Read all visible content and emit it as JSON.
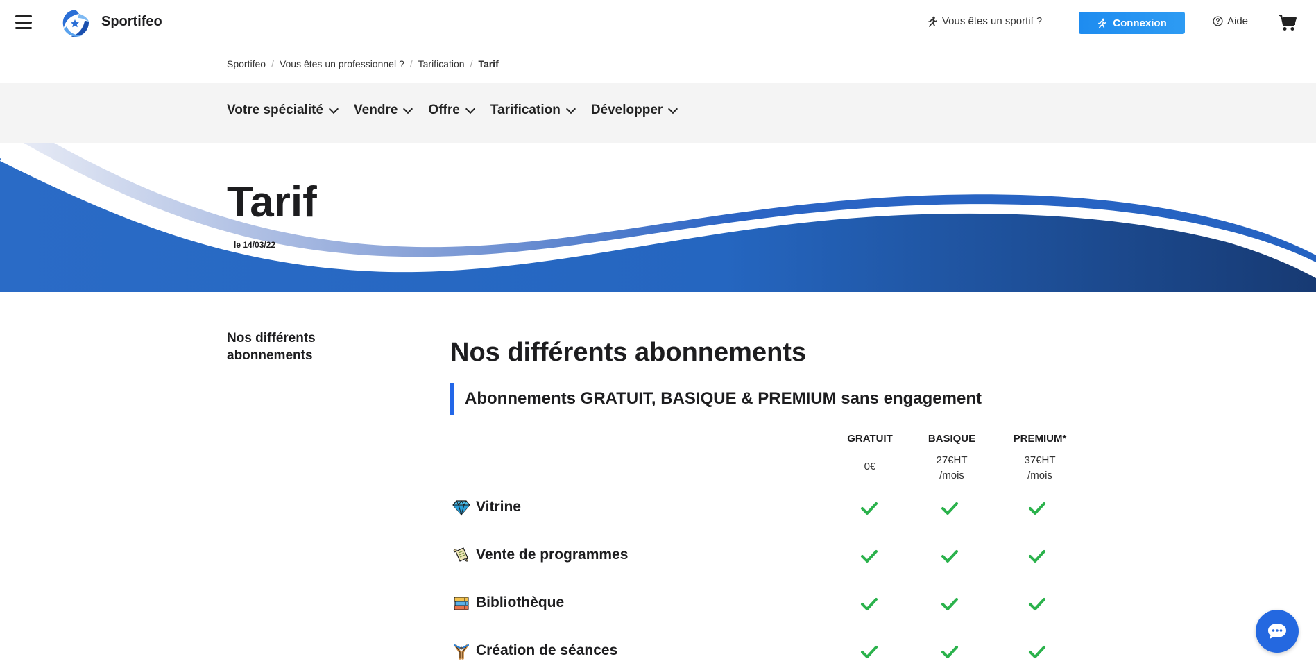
{
  "header": {
    "brand": "Sportifeo",
    "sportif_link": "Vous êtes un sportif ?",
    "connexion_label": "Connexion",
    "aide_label": "Aide"
  },
  "breadcrumb": [
    "Sportifeo",
    "Vous êtes un professionnel ?",
    "Tarification",
    "Tarif"
  ],
  "nav": [
    {
      "label": "Votre spécialité"
    },
    {
      "label": "Vendre"
    },
    {
      "label": "Offre"
    },
    {
      "label": "Tarification"
    },
    {
      "label": "Développer"
    }
  ],
  "hero": {
    "title": "Tarif",
    "date": "le 14/03/22"
  },
  "sidebar": {
    "item": "Nos différents abonnements"
  },
  "main": {
    "title": "Nos différents abonnements",
    "subtitle": "Abonnements GRATUIT, BASIQUE & PREMIUM sans engagement"
  },
  "plans": [
    {
      "name": "GRATUIT",
      "price": "0€",
      "period": ""
    },
    {
      "name": "BASIQUE",
      "price": "27€HT",
      "period": "/mois"
    },
    {
      "name": "PREMIUM*",
      "price": "37€HT",
      "period": "/mois"
    }
  ],
  "features": [
    {
      "label": "Vitrine",
      "icon": "gem-icon",
      "included": [
        true,
        true,
        true
      ]
    },
    {
      "label": "Vente de programmes",
      "icon": "scroll-icon",
      "included": [
        true,
        true,
        true
      ]
    },
    {
      "label": "Bibliothèque",
      "icon": "books-icon",
      "included": [
        true,
        true,
        true
      ]
    },
    {
      "label": "Création de séances",
      "icon": "slingshot-icon",
      "included": [
        true,
        true,
        true
      ]
    }
  ],
  "colors": {
    "accent": "#2367e8",
    "button": "#1e8cf0",
    "check": "#2bb24c",
    "wave_dark": "#1a3e78",
    "nav_bg": "#f4f4f4"
  }
}
